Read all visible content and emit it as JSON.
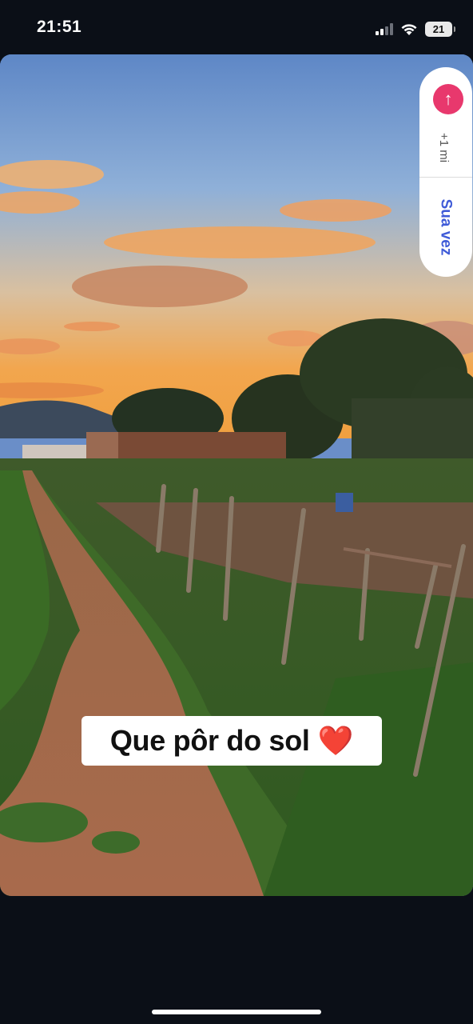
{
  "status_bar": {
    "time": "21:51",
    "battery_level": "21",
    "signal_bars_active": 2,
    "signal_bars_total": 4,
    "wifi_icon": "wifi-icon"
  },
  "story": {
    "caption": "Que pôr do sol",
    "caption_emoji": "❤️",
    "photo_description_icon": "sunset-photo"
  },
  "side_pill": {
    "icon": "reply-arrow-icon",
    "count_label": "+1 mi",
    "turn_label": "Sua vez",
    "accent_color": "#e8386d",
    "turn_color": "#3f5bd8"
  }
}
